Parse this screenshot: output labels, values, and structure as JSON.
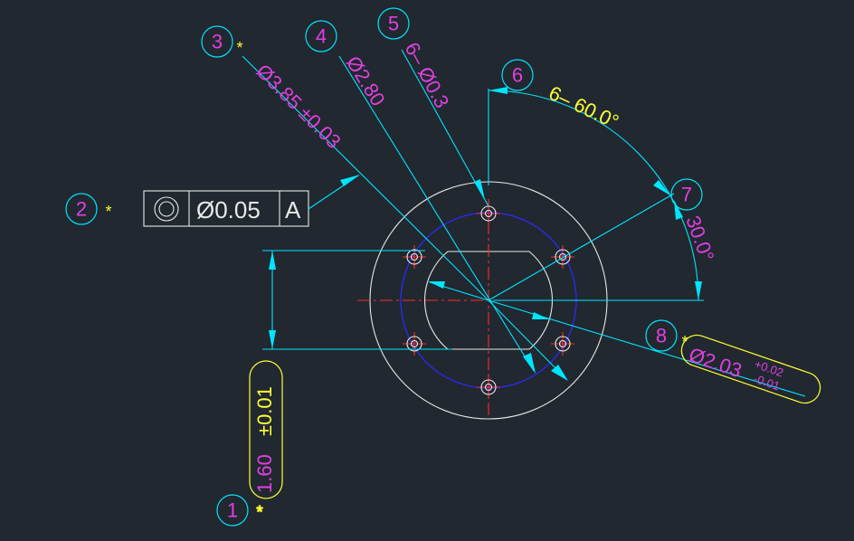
{
  "drawing": {
    "colors": {
      "background": "#212830",
      "dimension_line": "#00e5ff",
      "dimension_text": "#e040e0",
      "outline": "#e8e8e8",
      "centerline": "#ff2a2a",
      "bolt_circle": "#2a2ae6",
      "highlight": "#ffff33"
    },
    "balloons": [
      "1",
      "2",
      "3",
      "4",
      "5",
      "6",
      "7",
      "8"
    ],
    "inspection_mark": "*",
    "dimensions": {
      "d1_value": "1.60",
      "d1_tol": "±0.01",
      "d3": "Ø3.85 ±0.03",
      "d4": "Ø2.80",
      "d5": "6– Ø0.3",
      "d6": "6– 60.0°",
      "d7": "30.0°",
      "d8_value": "Ø2.03",
      "d8_upper": "+0.02",
      "d8_lower": "-0.01"
    },
    "feature_control_frame": {
      "symbol": "concentricity-icon",
      "tolerance": "Ø0.05",
      "datum": "A"
    }
  }
}
